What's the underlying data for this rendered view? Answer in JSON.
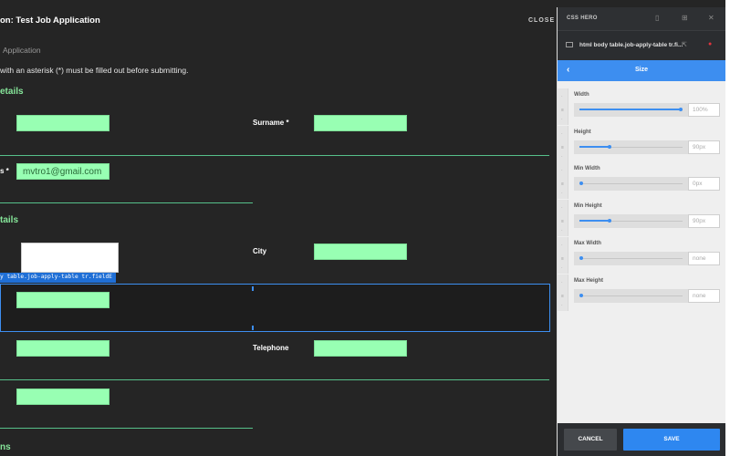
{
  "form": {
    "title": "on: Test Job Application",
    "close_label": "CLOSE",
    "subtitle": "Application",
    "note": "with an asterisk (*) must be filled out before submitting.",
    "section1": "etails",
    "section2": "tails",
    "section3": "ns",
    "surname_label": "Surname *",
    "email_label": "s *",
    "email_value": "mvtro1@gmail.com",
    "city_label": "City",
    "telephone_label": "Telephone",
    "selection_tag": "y table.job-apply-table tr.fieldE"
  },
  "panel": {
    "header_title": "CSS HERO",
    "path_text": "html body table.job-apply-table tr.fi...",
    "nav_back": "‹",
    "nav_title": "Size",
    "properties": [
      {
        "label": "Width",
        "value": "100%",
        "fill": 1.0
      },
      {
        "label": "Height",
        "value": "90px",
        "fill": 0.28
      },
      {
        "label": "Min Width",
        "value": "0px",
        "fill": 0.0
      },
      {
        "label": "Min Height",
        "value": "90px",
        "fill": 0.28
      },
      {
        "label": "Max Width",
        "value": "none",
        "fill": 0.0
      },
      {
        "label": "Max Height",
        "value": "none",
        "fill": 0.0
      }
    ],
    "cancel_label": "CANCEL",
    "save_label": "SAVE"
  },
  "colors": {
    "accent": "#3d8ef0",
    "field": "#98ffb3",
    "section_heading": "#86e69a",
    "delete": "#e0343e"
  },
  "icons": [
    "file-icon",
    "cursor-icon",
    "delete-icon",
    "mobile-icon",
    "add-layer-icon",
    "close-icon",
    "back-chevron-icon"
  ]
}
